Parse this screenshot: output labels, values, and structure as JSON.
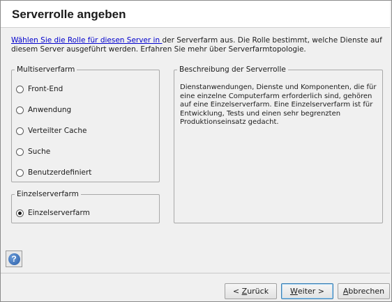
{
  "header": {
    "title": "Serverrolle angeben"
  },
  "intro": {
    "link_text": "Wählen Sie die Rolle für diesen Server in ",
    "text": "der Serverfarm aus. Die Rolle bestimmt, welche Dienste auf diesem Server ausgeführt werden. Erfahren Sie mehr über Serverfarmtopologie."
  },
  "multi_group": {
    "legend": "Multiserverfarm",
    "options": [
      {
        "label": "Front-End",
        "checked": false
      },
      {
        "label": "Anwendung",
        "checked": false
      },
      {
        "label": "Verteilter Cache",
        "checked": false
      },
      {
        "label": "Suche",
        "checked": false
      },
      {
        "label": "Benutzerdefiniert",
        "checked": false
      }
    ]
  },
  "single_group": {
    "legend": "Einzelserverfarm",
    "options": [
      {
        "label": "Einzelserverfarm",
        "checked": true
      }
    ]
  },
  "description": {
    "legend": "Beschreibung der Serverrolle",
    "text": "Dienstanwendungen, Dienste und Komponenten, die für eine einzelne Computerfarm erforderlich sind, gehören auf eine Einzelserverfarm. Eine Einzelserverfarm ist für Entwicklung, Tests und einen sehr begrenzten Produktionseinsatz gedacht."
  },
  "footer": {
    "help_icon": "help-icon",
    "back_prefix": "< ",
    "back_accel": "Z",
    "back_rest": "urück",
    "next_accel": "W",
    "next_rest": "eiter >",
    "cancel_accel": "A",
    "cancel_rest": "bbrechen"
  }
}
